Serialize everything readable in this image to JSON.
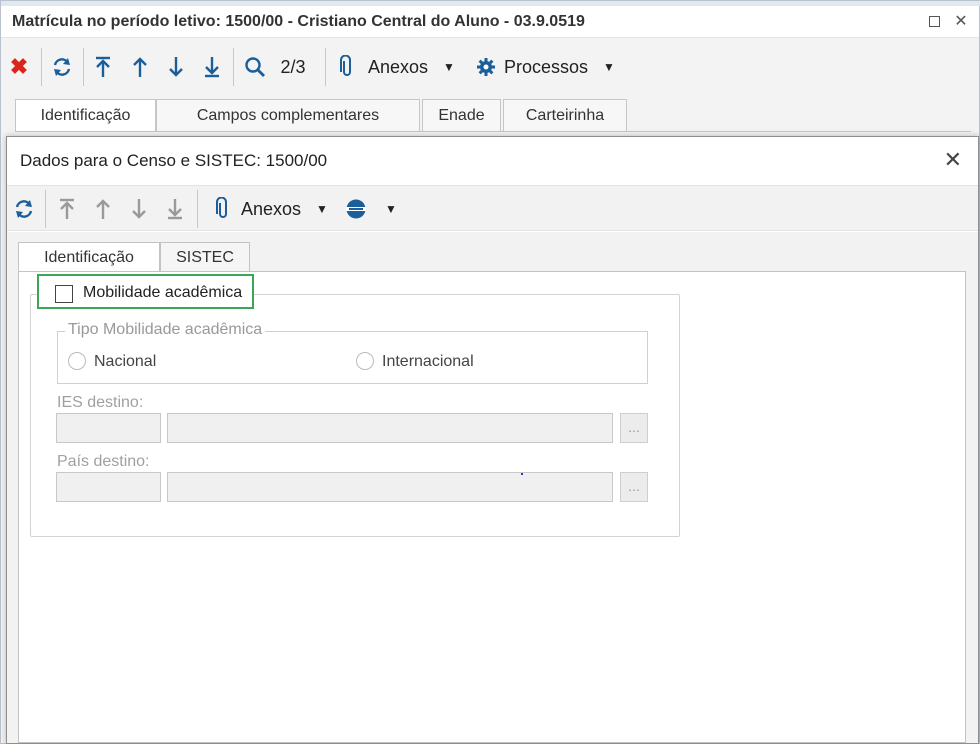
{
  "window": {
    "title": "Matrícula no período letivo: 1500/00 - Cristiano Central do Aluno - 03.9.0519"
  },
  "toolbar": {
    "record_position": "2/3",
    "anexos_label": "Anexos",
    "processos_label": "Processos"
  },
  "tabs": [
    {
      "label": "Identificação"
    },
    {
      "label": "Campos complementares"
    },
    {
      "label": "Enade"
    },
    {
      "label": "Carteirinha"
    }
  ],
  "dialog": {
    "title": "Dados para o Censo e SISTEC: 1500/00",
    "toolbar": {
      "anexos_label": "Anexos"
    },
    "tabs": [
      {
        "label": "Identificação"
      },
      {
        "label": "SISTEC"
      }
    ],
    "mobilidade": {
      "checkbox_label": "Mobilidade acadêmica",
      "checked": false,
      "tipo_legend": "Tipo Mobilidade acadêmica",
      "options": [
        {
          "label": "Nacional"
        },
        {
          "label": "Internacional"
        }
      ],
      "ies_label": "IES destino:",
      "pais_label": "País destino:",
      "lookup_label": "..."
    }
  },
  "colors": {
    "highlight_border": "#3aa757",
    "icon_blue": "#1a5e9a",
    "delete_red": "#d9261c"
  }
}
